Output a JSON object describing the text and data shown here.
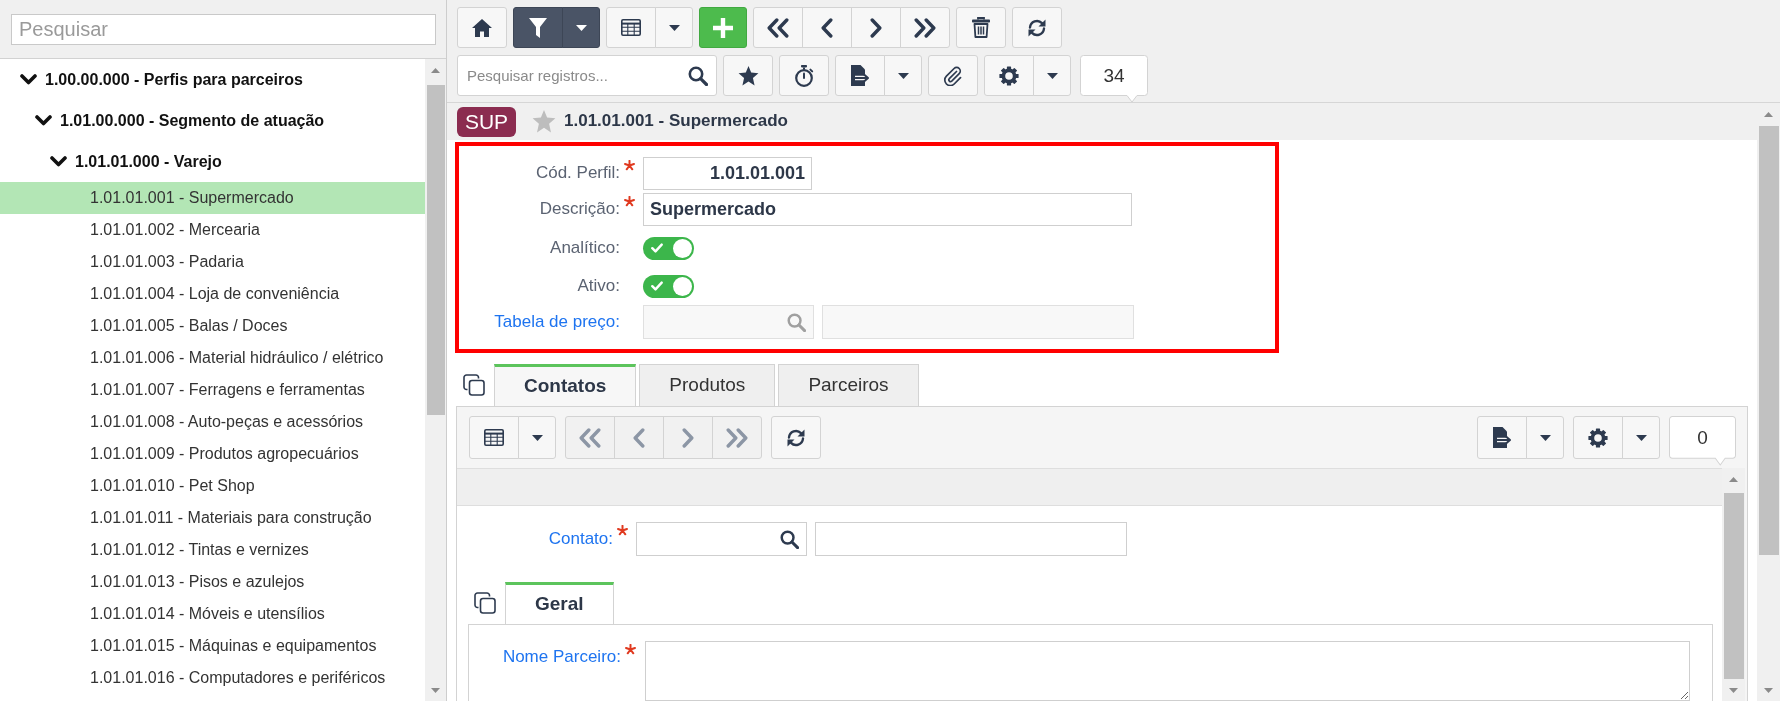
{
  "sidebar": {
    "search": {
      "placeholder": "Pesquisar"
    },
    "tree": [
      {
        "label": "1.00.00.000 - Perfis para parceiros",
        "expanded": true,
        "selected": false,
        "children": [
          {
            "label": "1.01.00.000 - Segmento de atuação",
            "expanded": true,
            "selected": false,
            "children": [
              {
                "label": "1.01.01.000 - Varejo",
                "expanded": true,
                "selected": false,
                "children": [
                  {
                    "label": "1.01.01.001 - Supermercado",
                    "selected": true
                  },
                  {
                    "label": "1.01.01.002 - Mercearia",
                    "selected": false
                  },
                  {
                    "label": "1.01.01.003 - Padaria",
                    "selected": false
                  },
                  {
                    "label": "1.01.01.004 - Loja de conveniência",
                    "selected": false
                  },
                  {
                    "label": "1.01.01.005 - Balas / Doces",
                    "selected": false
                  },
                  {
                    "label": "1.01.01.006 - Material hidráulico / elétrico",
                    "selected": false
                  },
                  {
                    "label": "1.01.01.007 - Ferragens e ferramentas",
                    "selected": false
                  },
                  {
                    "label": "1.01.01.008 - Auto-peças e acessórios",
                    "selected": false
                  },
                  {
                    "label": "1.01.01.009 - Produtos agropecuários",
                    "selected": false
                  },
                  {
                    "label": "1.01.01.010 - Pet Shop",
                    "selected": false
                  },
                  {
                    "label": "1.01.01.011 - Materiais para construção",
                    "selected": false
                  },
                  {
                    "label": "1.01.01.012 - Tintas e vernizes",
                    "selected": false
                  },
                  {
                    "label": "1.01.01.013 - Pisos e azulejos",
                    "selected": false
                  },
                  {
                    "label": "1.01.01.014 - Móveis e utensílios",
                    "selected": false
                  },
                  {
                    "label": "1.01.01.015 - Máquinas e equipamentos",
                    "selected": false
                  },
                  {
                    "label": "1.01.01.016 - Computadores e periféricos",
                    "selected": false
                  }
                ]
              }
            ]
          }
        ]
      }
    ]
  },
  "toolbar": {
    "filter_active": true,
    "navigation_disabled": false,
    "search": {
      "placeholder": "Pesquisar registros..."
    },
    "count": "34"
  },
  "record": {
    "badge": "SUP",
    "favorite": false,
    "title": "1.01.01.001 - Supermercado"
  },
  "form": {
    "highlighted": true,
    "fields": [
      {
        "kind": "code",
        "label": "Cód. Perfil:",
        "required": true,
        "link": false,
        "value": "1.01.01.001"
      },
      {
        "kind": "text",
        "label": "Descrição:",
        "required": true,
        "link": false,
        "value": "Supermercado"
      },
      {
        "kind": "switch",
        "label": "Analítico:",
        "required": false,
        "link": false,
        "on": true
      },
      {
        "kind": "switch",
        "label": "Ativo:",
        "required": false,
        "link": false,
        "on": true
      },
      {
        "kind": "lookup",
        "label": "Tabela de preço:",
        "required": false,
        "link": true,
        "disabled": true
      }
    ]
  },
  "tabs": [
    {
      "label": "Contatos",
      "selected": true
    },
    {
      "label": "Produtos",
      "selected": false
    },
    {
      "label": "Parceiros",
      "selected": false
    }
  ],
  "detail": {
    "navigation_disabled": true,
    "count": "0",
    "fields": [
      {
        "kind": "lookup",
        "label": "Contato:",
        "required": true,
        "link": true,
        "disabled": false
      }
    ],
    "tabs": [
      {
        "label": "Geral",
        "selected": true
      }
    ],
    "tab_fields": [
      {
        "kind": "textarea",
        "label": "Nome Parceiro:",
        "required": true,
        "link": true
      }
    ]
  }
}
